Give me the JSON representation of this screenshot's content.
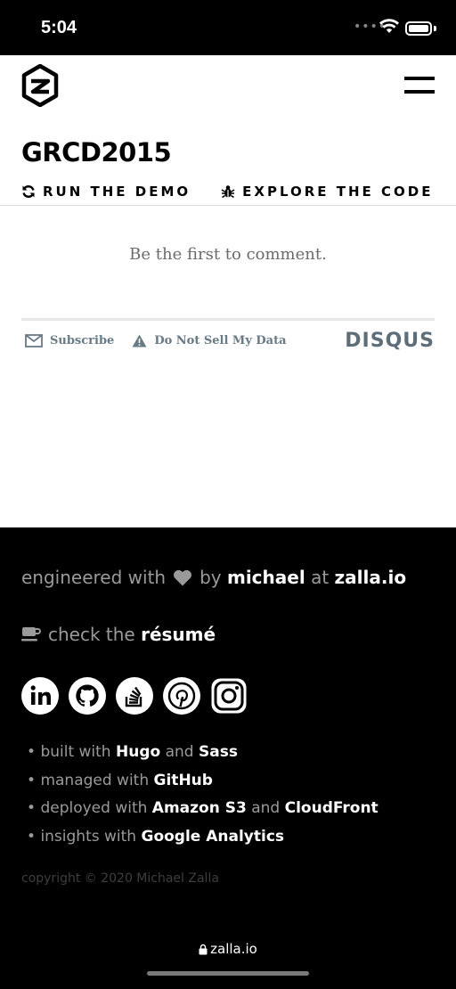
{
  "status": {
    "time": "5:04"
  },
  "header": {
    "title": "GRCD2015",
    "actions": [
      {
        "label": "RUN THE DEMO",
        "icon": "refresh-icon"
      },
      {
        "label": "EXPLORE THE CODE",
        "icon": "bug-icon"
      }
    ]
  },
  "comments": {
    "empty_text": "Be the first to comment.",
    "subscribe_label": "Subscribe",
    "do_not_sell_label": "Do Not Sell My Data",
    "brand": "DISQUS"
  },
  "footer": {
    "made_prefix": "engineered with",
    "made_by": "by",
    "author": "michael",
    "made_at": "at",
    "site": "zalla.io",
    "resume_prefix": "check the",
    "resume_link": "résumé",
    "socials": [
      "linkedin-icon",
      "github-icon",
      "stackoverflow-icon",
      "pinterest-icon",
      "instagram-icon"
    ],
    "list": [
      {
        "prefix": "built with",
        "a": "Hugo",
        "mid": "and",
        "b": "Sass"
      },
      {
        "prefix": "managed with",
        "a": "GitHub"
      },
      {
        "prefix": "deployed with",
        "a": "Amazon S3",
        "mid": "and",
        "b": "CloudFront"
      },
      {
        "prefix": "insights with",
        "a": "Google Analytics"
      }
    ],
    "copyright": "copyright © 2020 Michael Zalla"
  },
  "browser": {
    "url": "zalla.io"
  },
  "colors": {
    "footer_bg": "#000000",
    "muted": "#9a9a9a",
    "disqus": "#687a86"
  }
}
